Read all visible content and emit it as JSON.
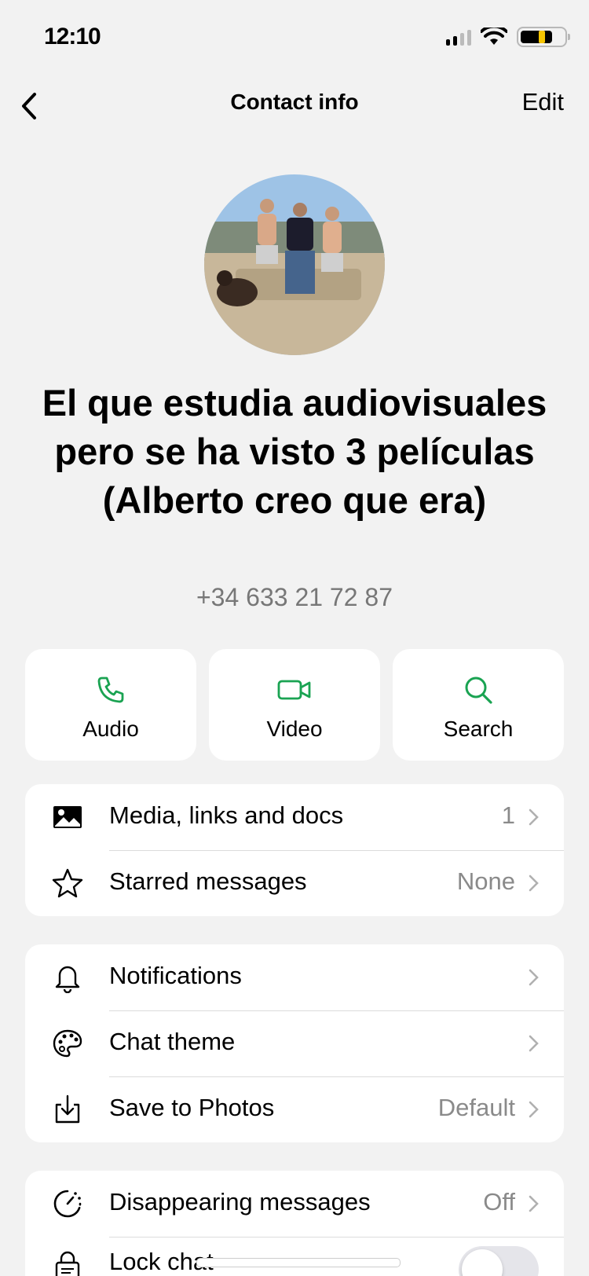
{
  "status_bar": {
    "time": "12:10"
  },
  "nav": {
    "back_label": "Back",
    "title": "Contact info",
    "edit": "Edit"
  },
  "contact": {
    "name": "El que estudia audiovisuales pero se ha visto 3 películas (Alberto creo que era)",
    "phone": "+34 633 21 72 87"
  },
  "actions": [
    {
      "label": "Audio",
      "icon": "phone-icon"
    },
    {
      "label": "Video",
      "icon": "video-icon"
    },
    {
      "label": "Search",
      "icon": "search-icon"
    }
  ],
  "section1": [
    {
      "label": "Media, links and docs",
      "value": "1",
      "icon": "image-icon"
    },
    {
      "label": "Starred messages",
      "value": "None",
      "icon": "star-icon"
    }
  ],
  "section2": [
    {
      "label": "Notifications",
      "value": "",
      "icon": "bell-icon"
    },
    {
      "label": "Chat theme",
      "value": "",
      "icon": "palette-icon"
    },
    {
      "label": "Save to Photos",
      "value": "Default",
      "icon": "download-icon"
    }
  ],
  "section3": [
    {
      "label": "Disappearing messages",
      "value": "Off",
      "icon": "timer-icon"
    },
    {
      "label": "Lock chat",
      "toggle": false,
      "icon": "lock-icon"
    }
  ],
  "colors": {
    "accent": "#1aa352",
    "background": "#f2f2f2",
    "card": "#ffffff",
    "secondary_text": "#8a8a8a"
  }
}
